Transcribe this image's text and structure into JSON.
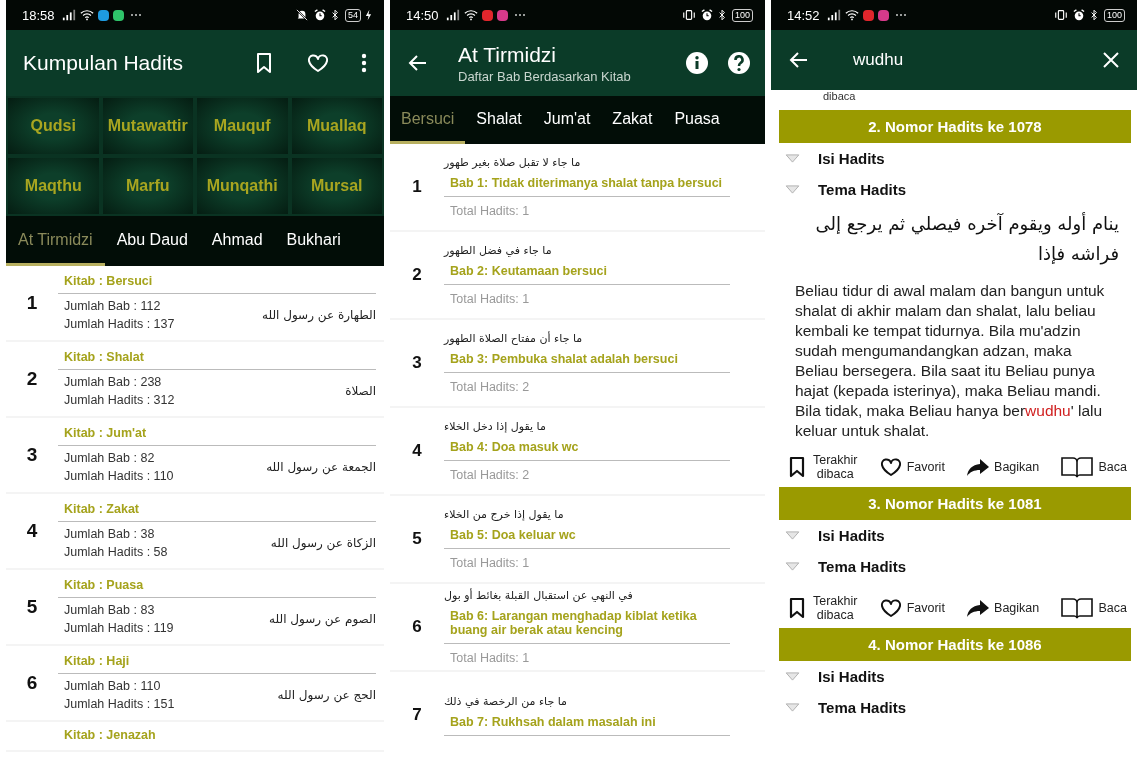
{
  "home_screen": {
    "status_bar": {
      "time": "18:58",
      "apps": [
        {
          "color": "#1e9be0"
        },
        {
          "color": "#2fc46a"
        }
      ],
      "indicators": [
        {
          "kind": "mute"
        },
        {
          "kind": "alarm"
        },
        {
          "kind": "bluetooth"
        }
      ],
      "battery": "54",
      "charging": true
    },
    "app_bar": {
      "title": "Kumpulan Hadits"
    },
    "categories": [
      "Qudsi",
      "Mutawattir",
      "Mauquf",
      "Muallaq",
      "Maqthu",
      "Marfu",
      "Munqathi",
      "Mursal"
    ],
    "tabs": [
      {
        "label": "At Tirmidzi",
        "selected": true
      },
      {
        "label": "Abu Daud",
        "selected": false
      },
      {
        "label": "Ahmad",
        "selected": false
      },
      {
        "label": "Bukhari",
        "selected": false
      }
    ],
    "kitab_list": [
      {
        "number": "1",
        "title": "Kitab : Bersuci",
        "bab_count": "Jumlah Bab : 112",
        "hadits_count": "Jumlah Hadits : 137",
        "arabic": "الطهارة عن رسول الله"
      },
      {
        "number": "2",
        "title": "Kitab : Shalat",
        "bab_count": "Jumlah Bab : 238",
        "hadits_count": "Jumlah Hadits : 312",
        "arabic": "الصلاة"
      },
      {
        "number": "3",
        "title": "Kitab : Jum'at",
        "bab_count": "Jumlah Bab : 82",
        "hadits_count": "Jumlah Hadits : 110",
        "arabic": "الجمعة عن رسول الله"
      },
      {
        "number": "4",
        "title": "Kitab : Zakat",
        "bab_count": "Jumlah Bab : 38",
        "hadits_count": "Jumlah Hadits : 58",
        "arabic": "الزكاة عن رسول الله"
      },
      {
        "number": "5",
        "title": "Kitab : Puasa",
        "bab_count": "Jumlah Bab : 83",
        "hadits_count": "Jumlah Hadits : 119",
        "arabic": "الصوم عن رسول الله"
      },
      {
        "number": "6",
        "title": "Kitab : Haji",
        "bab_count": "Jumlah Bab : 110",
        "hadits_count": "Jumlah Hadits : 151",
        "arabic": "الحج عن رسول الله"
      },
      {
        "title": "Kitab : Jenazah"
      }
    ]
  },
  "chapter_screen": {
    "status_bar": {
      "time": "14:50",
      "apps": [
        {
          "color": "#e0262c"
        },
        {
          "color": "#d63a8a"
        }
      ],
      "indicators": [
        {
          "kind": "vibrate"
        },
        {
          "kind": "alarm"
        },
        {
          "kind": "bluetooth"
        }
      ],
      "battery": "100",
      "charging": false
    },
    "app_bar": {
      "title": "At Tirmidzi",
      "subtitle": "Daftar Bab Berdasarkan Kitab"
    },
    "tabs": [
      {
        "label": "Bersuci",
        "selected": true
      },
      {
        "label": "Shalat",
        "selected": false
      },
      {
        "label": "Jum'at",
        "selected": false
      },
      {
        "label": "Zakat",
        "selected": false
      },
      {
        "label": "Puasa",
        "selected": false
      }
    ],
    "bab_list": [
      {
        "number": "1",
        "arabic": "ما جاء لا تقبل صلاة بغير طهور",
        "title": "Bab 1: Tidak diterimanya shalat tanpa bersuci",
        "total": "Total Hadits: 1"
      },
      {
        "number": "2",
        "arabic": "ما جاء في فضل الطهور",
        "title": "Bab 2: Keutamaan bersuci",
        "total": "Total Hadits: 1"
      },
      {
        "number": "3",
        "arabic": "ما جاء أن مفتاح الصلاة الطهور",
        "title": "Bab 3: Pembuka shalat adalah bersuci",
        "total": "Total Hadits: 2"
      },
      {
        "number": "4",
        "arabic": "ما يقول إذا دخل الخلاء",
        "title": "Bab 4: Doa masuk wc",
        "total": "Total Hadits: 2"
      },
      {
        "number": "5",
        "arabic": "ما يقول إذا خرج من الخلاء",
        "title": "Bab 5: Doa keluar wc",
        "total": "Total Hadits: 1"
      },
      {
        "number": "6",
        "arabic": "في النهي عن استقبال القبلة بغائط أو بول",
        "title": "Bab 6: Larangan menghadap kiblat ketika buang air berak atau kencing",
        "total": "Total Hadits: 1"
      },
      {
        "number": "7",
        "arabic": "ما جاء من الرخصة في ذلك",
        "title": "Bab 7: Rukhsah dalam masalah ini"
      }
    ]
  },
  "search_screen": {
    "status_bar": {
      "time": "14:52",
      "apps": [
        {
          "color": "#e0262c"
        },
        {
          "color": "#d63a8a"
        }
      ],
      "indicators": [
        {
          "kind": "vibrate"
        },
        {
          "kind": "alarm"
        },
        {
          "kind": "bluetooth"
        }
      ],
      "battery": "100",
      "charging": false
    },
    "search": {
      "value": "wudhu"
    },
    "partial_action_label": "dibaca",
    "results": [
      {
        "header": "2. Nomor Hadits ke 1078",
        "sections": [
          "Isi Hadits",
          "Tema Hadits"
        ],
        "arabic": "ينام أوله ويقوم آخره فيصلي ثم يرجع إلى فراشه فإذا",
        "translation": [
          {
            "text": "Beliau tidur di awal malam dan bangun untuk shalat di akhir malam dan shalat, lalu beliau kembali ke tempat tidurnya. Bila mu'adzin sudah mengumandangkan adzan, maka Beliau bersegera. Bila saat itu Beliau punya hajat (kepada isterinya), maka Beliau mandi. Bila tidak, maka Beliau hanya ber",
            "highlight": false
          },
          {
            "text": "wudhu",
            "highlight": true
          },
          {
            "text": "' lalu keluar untuk shalat.",
            "highlight": false
          }
        ],
        "actions": [
          {
            "kind": "bookmark",
            "label": "Terakhir dibaca"
          },
          {
            "kind": "heart",
            "label": "Favorit"
          },
          {
            "kind": "share",
            "label": "Bagikan"
          },
          {
            "kind": "book",
            "label": "Baca"
          }
        ]
      },
      {
        "header": "3. Nomor Hadits ke 1081",
        "sections": [
          "Isi Hadits",
          "Tema Hadits"
        ],
        "actions": [
          {
            "kind": "bookmark",
            "label": "Terakhir dibaca"
          },
          {
            "kind": "heart",
            "label": "Favorit"
          },
          {
            "kind": "share",
            "label": "Bagikan"
          },
          {
            "kind": "book",
            "label": "Baca"
          }
        ]
      },
      {
        "header": "4. Nomor Hadits ke 1086",
        "sections": [
          "Isi Hadits",
          "Tema Hadits"
        ]
      }
    ]
  }
}
